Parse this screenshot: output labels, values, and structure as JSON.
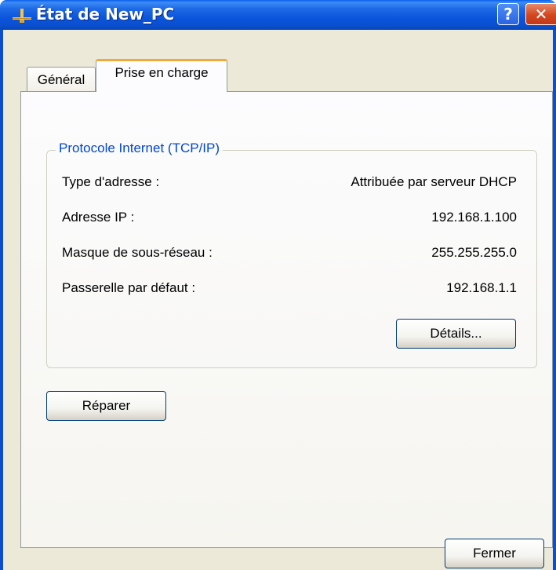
{
  "window": {
    "title": "État de New_PC",
    "help_label": "?",
    "close_label": "✕"
  },
  "tabs": [
    {
      "label": "Général",
      "active": false
    },
    {
      "label": "Prise en charge",
      "active": true
    }
  ],
  "group": {
    "title": "Protocole Internet (TCP/IP)",
    "rows": [
      {
        "label": "Type d'adresse :",
        "value": "Attribuée par serveur DHCP"
      },
      {
        "label": "Adresse IP :",
        "value": "192.168.1.100"
      },
      {
        "label": "Masque de sous-réseau :",
        "value": "255.255.255.0"
      },
      {
        "label": "Passerelle par défaut :",
        "value": "192.168.1.1"
      }
    ],
    "details_button": "Détails..."
  },
  "repair_button": "Réparer",
  "close_button": "Fermer",
  "colors": {
    "titlebar": "#0a55dd",
    "dialog_bg": "#ece9d8",
    "group_title": "#0046d5",
    "active_tab_accent": "#f2a93b"
  },
  "icons": {
    "app": "network-connection-icon",
    "help": "help-icon",
    "close": "close-icon"
  }
}
